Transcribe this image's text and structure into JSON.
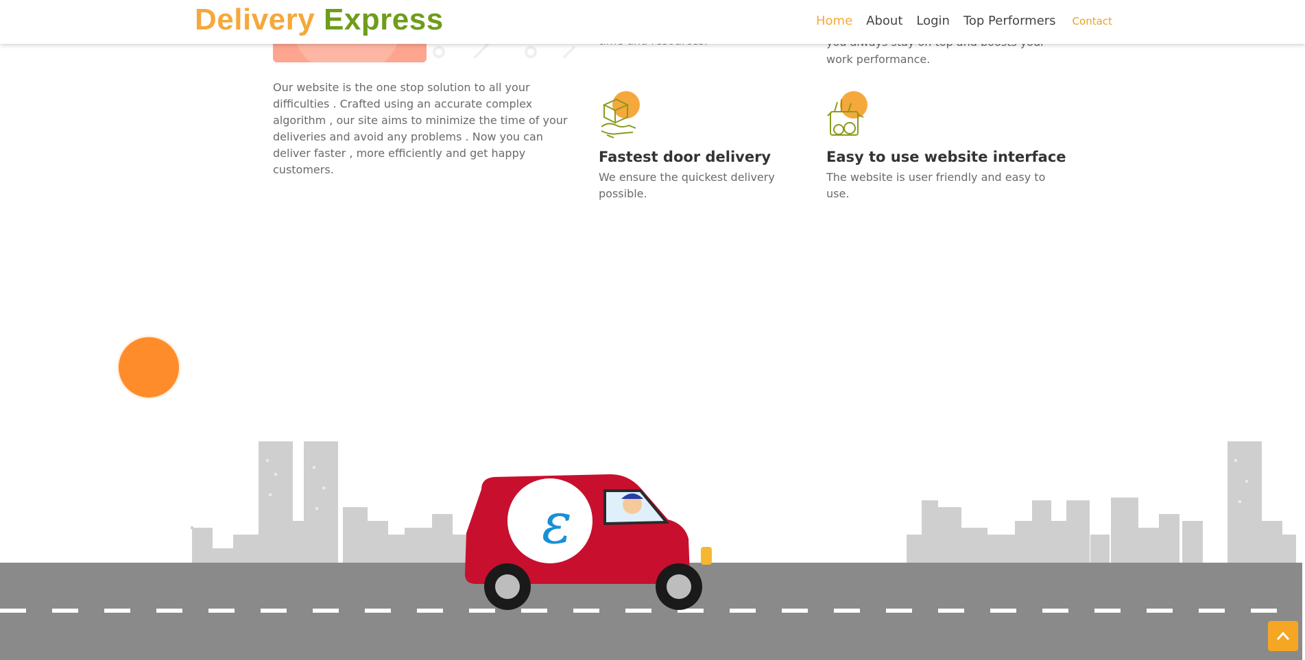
{
  "brand": {
    "word1": "Delivery",
    "word2": "Express"
  },
  "nav": {
    "home": "Home",
    "about": "About",
    "login": "Login",
    "performers": "Top Performers",
    "contact": "Contact"
  },
  "partial": {
    "mid_fragment": "time and resources.",
    "right_line1": "you always stay on top and boosts your",
    "right_line2": "work performance."
  },
  "intro": "Our website is the one stop solution to all your difficulties . Crafted using an accurate complex algorithm , our site aims to minimize the time of your deliveries and avoid any problems . Now you can deliver faster , more efficiently and get happy customers.",
  "features": [
    {
      "title": "Fastest door delivery",
      "text": "We ensure the quickest delivery possible.",
      "icon": "box-hand-icon"
    },
    {
      "title": "Easy to use website interface",
      "text": "The website is user friendly and easy to use.",
      "icon": "grocery-bag-icon"
    }
  ],
  "colors": {
    "accent": "#f5a83b",
    "green": "#6f9c1c",
    "orange_ball": "#ff8c2a",
    "van": "#c8102e",
    "road": "#8a8a8a",
    "skyline": "#cfcfcf"
  },
  "scroll_top_icon": "chevron-up-icon"
}
